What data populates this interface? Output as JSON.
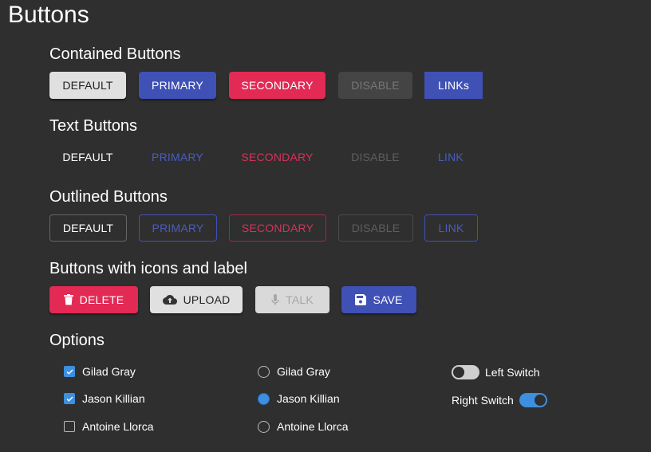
{
  "page": {
    "title": "Buttons"
  },
  "contained": {
    "title": "Contained Buttons",
    "buttons": [
      "DEFAULT",
      "PRIMARY",
      "SECONDARY",
      "DISABLE",
      "LINKs"
    ]
  },
  "text": {
    "title": "Text Buttons",
    "buttons": [
      "DEFAULT",
      "PRIMARY",
      "SECONDARY",
      "DISABLE",
      "LINK"
    ]
  },
  "outlined": {
    "title": "Outlined Buttons",
    "buttons": [
      "DEFAULT",
      "PRIMARY",
      "SECONDARY",
      "DISABLE",
      "LINK"
    ]
  },
  "icons": {
    "title": "Buttons with icons and label",
    "buttons": [
      {
        "label": "DELETE",
        "icon": "trash-icon"
      },
      {
        "label": "UPLOAD",
        "icon": "cloud-upload-icon"
      },
      {
        "label": "TALK",
        "icon": "microphone-icon"
      },
      {
        "label": "SAVE",
        "icon": "floppy-disk-icon"
      }
    ]
  },
  "options": {
    "title": "Options",
    "checkboxes": [
      {
        "label": "Gilad Gray",
        "checked": true
      },
      {
        "label": "Jason Killian",
        "checked": true
      },
      {
        "label": "Antoine Llorca",
        "checked": false
      }
    ],
    "radios": [
      {
        "label": "Gilad Gray",
        "selected": false
      },
      {
        "label": "Jason Killian",
        "selected": true
      },
      {
        "label": "Antoine Llorca",
        "selected": false
      }
    ],
    "switches": [
      {
        "label": "Left Switch",
        "on": false
      },
      {
        "label": "Right Switch",
        "on": true
      }
    ]
  },
  "colors": {
    "primary": "#3f51b5",
    "secondary": "#e22a55",
    "accent_blue": "#3d8fe0",
    "background": "#2f2f2f"
  }
}
